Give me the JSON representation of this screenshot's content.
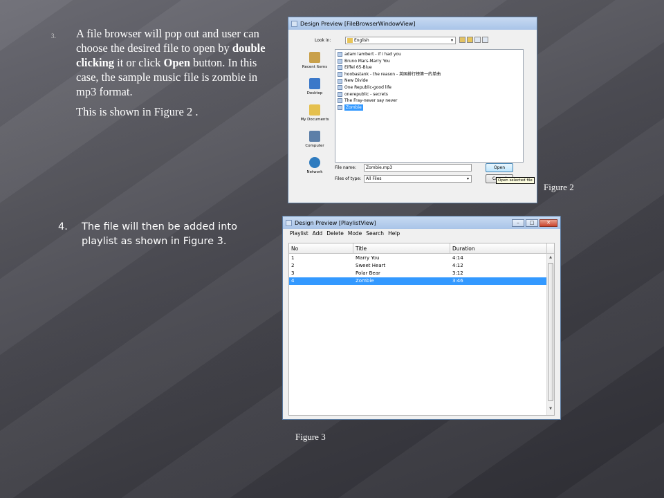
{
  "slide": {
    "step3": {
      "number": "3.",
      "text_a": "A file browser will pop out and user can choose the desired file to open by ",
      "bold_a": "double clicking",
      "text_b": " it or click ",
      "bold_b": "Open",
      "text_c": " button.  In this case, the sample music file is zombie in mp3 format.",
      "shown": "This is shown in Figure 2 ."
    },
    "step4": {
      "number": "4.",
      "text": "The file will then be added into playlist as shown in Figure 3."
    },
    "caption_fig2": "Figure 2",
    "caption_fig3": "Figure 3"
  },
  "file_browser": {
    "title": "Design Preview [FileBrowserWindowView]",
    "look_in_label": "Look in:",
    "look_in_value": "English",
    "places": [
      {
        "label": "Recent Items",
        "icon": "recent-items-icon",
        "color": "#c9a04a"
      },
      {
        "label": "Desktop",
        "icon": "desktop-icon",
        "color": "#3b78c9"
      },
      {
        "label": "My Documents",
        "icon": "my-documents-icon",
        "color": "#e5c04e"
      },
      {
        "label": "Computer",
        "icon": "computer-icon",
        "color": "#5c7fa8"
      },
      {
        "label": "Network",
        "icon": "network-icon",
        "color": "#2e7bbf"
      }
    ],
    "files": [
      "adam lambert - if i had you",
      "Bruno Mars-Marry You",
      "Eiffel 65-Blue",
      "hoobastank - the reason - 英国排行榜第一的单曲",
      "New Divide",
      "One Republic-good life",
      "onerepublic - secrets",
      "The Fray-never say never",
      "Zombie"
    ],
    "selected_file": "Zombie",
    "file_name_label": "File name:",
    "file_name_value": "Zombie.mp3",
    "files_of_type_label": "Files of type:",
    "files_of_type_value": "All Files",
    "open_label": "Open",
    "cancel_label": "Cancel",
    "tooltip": "Open selected file"
  },
  "playlist": {
    "title": "Design Preview [PlaylistView]",
    "menu": [
      "Playlist",
      "Add",
      "Delete",
      "Mode",
      "Search",
      "Help"
    ],
    "columns": [
      "No",
      "Title",
      "Duration"
    ],
    "rows": [
      {
        "no": "1",
        "title": "Marry You",
        "duration": "4:14"
      },
      {
        "no": "2",
        "title": "Sweet Heart",
        "duration": "4:12"
      },
      {
        "no": "3",
        "title": "Polar Bear",
        "duration": "3:12"
      },
      {
        "no": "4",
        "title": "Zombie",
        "duration": "3:46"
      }
    ],
    "selected_row": 3
  },
  "window_buttons": {
    "minimize": "–",
    "maximize": "□",
    "close": "✕"
  },
  "colors": {
    "selection": "#3399ff",
    "tooltip_bg": "#ffffe1"
  }
}
